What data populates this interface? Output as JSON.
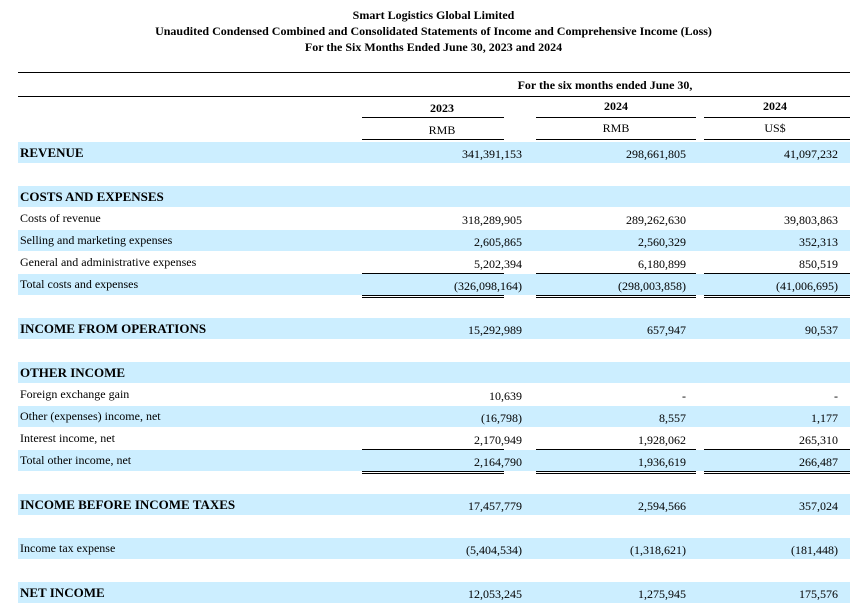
{
  "header": {
    "company": "Smart Logistics Global Limited",
    "statement": "Unaudited Condensed Combined and Consolidated Statements of Income and Comprehensive Income (Loss)",
    "period": "For the Six Months Ended June 30, 2023 and 2024"
  },
  "columns": {
    "period_caption": "For the six months ended June 30,",
    "years": [
      "2023",
      "2024",
      "2024"
    ],
    "currencies": [
      "RMB",
      "RMB",
      "US$"
    ]
  },
  "rows": [
    {
      "label": "REVENUE",
      "bold": true,
      "shaded": true,
      "values": [
        "341,391,153",
        "298,661,805",
        "41,097,232"
      ]
    },
    {
      "label": "",
      "bold": false,
      "shaded": false,
      "values": [
        "",
        "",
        ""
      ]
    },
    {
      "label": "COSTS AND EXPENSES",
      "bold": true,
      "shaded": true,
      "values": [
        "",
        "",
        ""
      ]
    },
    {
      "label": "Costs of revenue",
      "bold": false,
      "shaded": false,
      "values": [
        "318,289,905",
        "289,262,630",
        "39,803,863"
      ]
    },
    {
      "label": "Selling and marketing expenses",
      "bold": false,
      "shaded": true,
      "values": [
        "2,605,865",
        "2,560,329",
        "352,313"
      ]
    },
    {
      "label": "General and administrative expenses",
      "bold": false,
      "shaded": false,
      "values": [
        "5,202,394",
        "6,180,899",
        "850,519"
      ]
    },
    {
      "label": "Total costs and expenses",
      "bold": false,
      "shaded": true,
      "values": [
        "(326,098,164)",
        "(298,003,858)",
        "(41,006,695)"
      ]
    },
    {
      "label": "",
      "bold": false,
      "shaded": false,
      "values": [
        "",
        "",
        ""
      ]
    },
    {
      "label": "INCOME FROM OPERATIONS",
      "bold": true,
      "shaded": true,
      "values": [
        "15,292,989",
        "657,947",
        "90,537"
      ]
    },
    {
      "label": "",
      "bold": false,
      "shaded": false,
      "values": [
        "",
        "",
        ""
      ]
    },
    {
      "label": "OTHER INCOME",
      "bold": true,
      "shaded": true,
      "values": [
        "",
        "",
        ""
      ]
    },
    {
      "label": "Foreign exchange gain",
      "bold": false,
      "shaded": false,
      "values": [
        "10,639",
        "-",
        "-"
      ]
    },
    {
      "label": "Other (expenses) income, net",
      "bold": false,
      "shaded": true,
      "values": [
        "(16,798)",
        "8,557",
        "1,177"
      ]
    },
    {
      "label": "Interest income, net",
      "bold": false,
      "shaded": false,
      "values": [
        "2,170,949",
        "1,928,062",
        "265,310"
      ]
    },
    {
      "label": "Total other income, net",
      "bold": false,
      "shaded": true,
      "values": [
        "2,164,790",
        "1,936,619",
        "266,487"
      ]
    },
    {
      "label": "",
      "bold": false,
      "shaded": false,
      "values": [
        "",
        "",
        ""
      ]
    },
    {
      "label": "INCOME BEFORE INCOME TAXES",
      "bold": true,
      "shaded": true,
      "values": [
        "17,457,779",
        "2,594,566",
        "357,024"
      ]
    },
    {
      "label": "",
      "bold": false,
      "shaded": false,
      "values": [
        "",
        "",
        ""
      ]
    },
    {
      "label": "Income tax expense",
      "bold": false,
      "shaded": true,
      "values": [
        "(5,404,534)",
        "(1,318,621)",
        "(181,448)"
      ]
    },
    {
      "label": "",
      "bold": false,
      "shaded": false,
      "values": [
        "",
        "",
        ""
      ]
    },
    {
      "label": "NET INCOME",
      "bold": true,
      "shaded": true,
      "values": [
        "12,053,245",
        "1,275,945",
        "175,576"
      ]
    }
  ]
}
